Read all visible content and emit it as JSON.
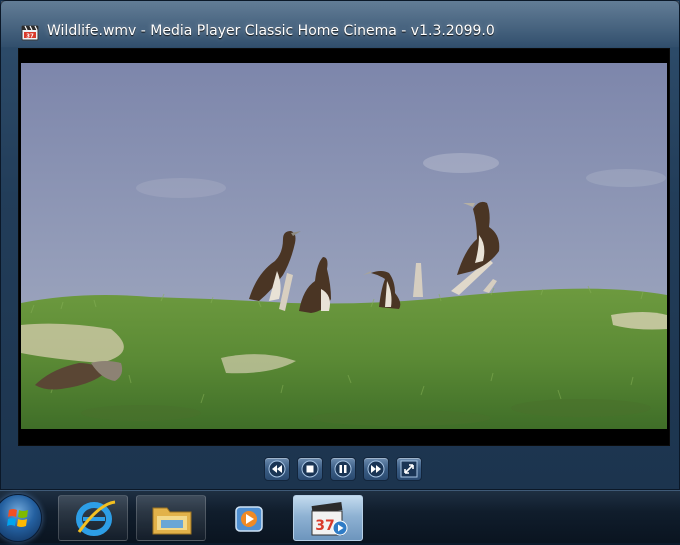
{
  "window": {
    "title": "Wildlife.wmv - Media Player Classic Home Cinema - v1.3.2099.0",
    "app_icon": "mpc-hc-icon"
  },
  "video": {
    "content": "birds-on-grassy-dune-frame"
  },
  "controls": [
    {
      "name": "rewind-button",
      "icon": "rewind-icon"
    },
    {
      "name": "stop-button",
      "icon": "stop-icon"
    },
    {
      "name": "pause-button",
      "icon": "pause-icon"
    },
    {
      "name": "fast-forward-button",
      "icon": "fast-forward-icon"
    },
    {
      "name": "fullscreen-button",
      "icon": "fullscreen-icon"
    }
  ],
  "taskbar": {
    "start": "windows-start-icon",
    "items": [
      {
        "name": "internet-explorer",
        "icon": "internet-explorer-icon",
        "active": false
      },
      {
        "name": "windows-explorer",
        "icon": "folder-icon",
        "active": false
      },
      {
        "name": "windows-media-player",
        "icon": "media-player-icon",
        "active": false
      },
      {
        "name": "mpc-hc",
        "icon": "mpc-hc-icon",
        "active": true
      }
    ]
  },
  "colors": {
    "window_frame": "#2c4a68",
    "control_button": "#3b5d84",
    "sky": "#8d97b6",
    "grass": "#5f8c38",
    "taskbar": "#101d2c",
    "active_task": "#8fb2d3"
  }
}
